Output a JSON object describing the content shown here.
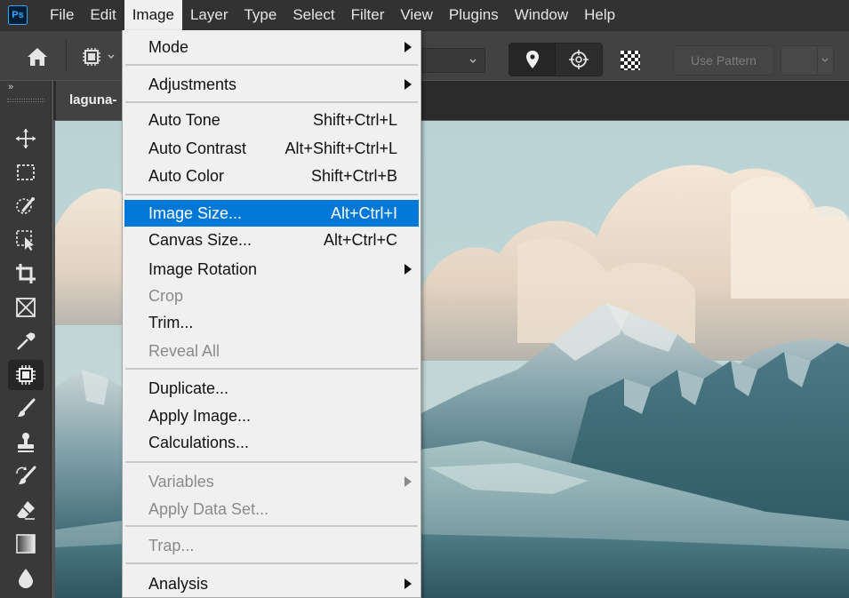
{
  "app": {
    "logo": "Ps"
  },
  "menubar": {
    "items": [
      "File",
      "Edit",
      "Image",
      "Layer",
      "Type",
      "Select",
      "Filter",
      "View",
      "Plugins",
      "Window",
      "Help"
    ],
    "active": "Image"
  },
  "options": {
    "use_pattern_label": "Use Pattern",
    "home_icon": "home-icon",
    "tool_icon": "content-aware-move-icon"
  },
  "toolbox": {
    "collapse_label": "»",
    "tools": [
      {
        "name": "move-tool",
        "icon": "move-icon",
        "selected": false
      },
      {
        "name": "marquee-tool",
        "icon": "marquee-icon",
        "selected": false
      },
      {
        "name": "quick-selection-tool",
        "icon": "quick-selection-icon",
        "selected": false
      },
      {
        "name": "object-selection-tool",
        "icon": "object-selection-icon",
        "selected": false
      },
      {
        "name": "crop-tool",
        "icon": "crop-icon",
        "selected": false
      },
      {
        "name": "frame-tool",
        "icon": "frame-icon",
        "selected": false
      },
      {
        "name": "eyedropper-tool",
        "icon": "eyedropper-icon",
        "selected": false
      },
      {
        "name": "healing-tool",
        "icon": "healing-icon",
        "selected": true
      },
      {
        "name": "brush-tool",
        "icon": "brush-icon",
        "selected": false
      },
      {
        "name": "clone-stamp-tool",
        "icon": "stamp-icon",
        "selected": false
      },
      {
        "name": "history-brush-tool",
        "icon": "history-brush-icon",
        "selected": false
      },
      {
        "name": "eraser-tool",
        "icon": "eraser-icon",
        "selected": false
      },
      {
        "name": "gradient-tool",
        "icon": "gradient-icon",
        "selected": false
      },
      {
        "name": "blur-tool",
        "icon": "blur-icon",
        "selected": false
      }
    ]
  },
  "document": {
    "tab_label": "laguna-"
  },
  "image_menu": {
    "mode": "Mode",
    "adjustments": "Adjustments",
    "auto_tone": "Auto Tone",
    "auto_tone_sc": "Shift+Ctrl+L",
    "auto_contrast": "Auto Contrast",
    "auto_contrast_sc": "Alt+Shift+Ctrl+L",
    "auto_color": "Auto Color",
    "auto_color_sc": "Shift+Ctrl+B",
    "image_size": "Image Size...",
    "image_size_sc": "Alt+Ctrl+I",
    "canvas_size": "Canvas Size...",
    "canvas_size_sc": "Alt+Ctrl+C",
    "image_rotation": "Image Rotation",
    "crop": "Crop",
    "trim": "Trim...",
    "reveal_all": "Reveal All",
    "duplicate": "Duplicate...",
    "apply_image": "Apply Image...",
    "calculations": "Calculations...",
    "variables": "Variables",
    "apply_data_set": "Apply Data Set...",
    "trap": "Trap...",
    "analysis": "Analysis"
  },
  "colors": {
    "menubar_bg": "#323232",
    "menu_highlight": "#0078d7",
    "ps_accent": "#31a8ff"
  }
}
